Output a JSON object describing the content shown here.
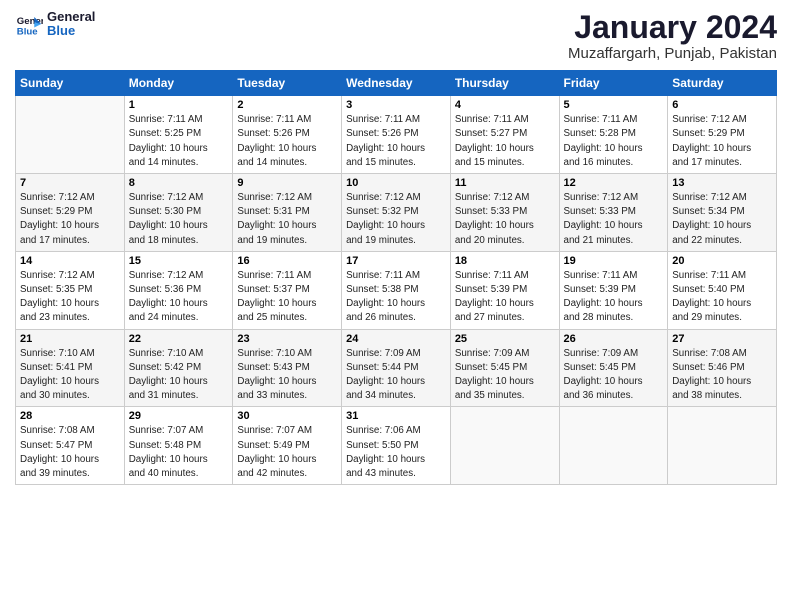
{
  "logo": {
    "line1": "General",
    "line2": "Blue"
  },
  "title": "January 2024",
  "subtitle": "Muzaffargarh, Punjab, Pakistan",
  "days_header": [
    "Sunday",
    "Monday",
    "Tuesday",
    "Wednesday",
    "Thursday",
    "Friday",
    "Saturday"
  ],
  "weeks": [
    [
      {
        "num": "",
        "info": ""
      },
      {
        "num": "1",
        "info": "Sunrise: 7:11 AM\nSunset: 5:25 PM\nDaylight: 10 hours\nand 14 minutes."
      },
      {
        "num": "2",
        "info": "Sunrise: 7:11 AM\nSunset: 5:26 PM\nDaylight: 10 hours\nand 14 minutes."
      },
      {
        "num": "3",
        "info": "Sunrise: 7:11 AM\nSunset: 5:26 PM\nDaylight: 10 hours\nand 15 minutes."
      },
      {
        "num": "4",
        "info": "Sunrise: 7:11 AM\nSunset: 5:27 PM\nDaylight: 10 hours\nand 15 minutes."
      },
      {
        "num": "5",
        "info": "Sunrise: 7:11 AM\nSunset: 5:28 PM\nDaylight: 10 hours\nand 16 minutes."
      },
      {
        "num": "6",
        "info": "Sunrise: 7:12 AM\nSunset: 5:29 PM\nDaylight: 10 hours\nand 17 minutes."
      }
    ],
    [
      {
        "num": "7",
        "info": "Sunrise: 7:12 AM\nSunset: 5:29 PM\nDaylight: 10 hours\nand 17 minutes."
      },
      {
        "num": "8",
        "info": "Sunrise: 7:12 AM\nSunset: 5:30 PM\nDaylight: 10 hours\nand 18 minutes."
      },
      {
        "num": "9",
        "info": "Sunrise: 7:12 AM\nSunset: 5:31 PM\nDaylight: 10 hours\nand 19 minutes."
      },
      {
        "num": "10",
        "info": "Sunrise: 7:12 AM\nSunset: 5:32 PM\nDaylight: 10 hours\nand 19 minutes."
      },
      {
        "num": "11",
        "info": "Sunrise: 7:12 AM\nSunset: 5:33 PM\nDaylight: 10 hours\nand 20 minutes."
      },
      {
        "num": "12",
        "info": "Sunrise: 7:12 AM\nSunset: 5:33 PM\nDaylight: 10 hours\nand 21 minutes."
      },
      {
        "num": "13",
        "info": "Sunrise: 7:12 AM\nSunset: 5:34 PM\nDaylight: 10 hours\nand 22 minutes."
      }
    ],
    [
      {
        "num": "14",
        "info": "Sunrise: 7:12 AM\nSunset: 5:35 PM\nDaylight: 10 hours\nand 23 minutes."
      },
      {
        "num": "15",
        "info": "Sunrise: 7:12 AM\nSunset: 5:36 PM\nDaylight: 10 hours\nand 24 minutes."
      },
      {
        "num": "16",
        "info": "Sunrise: 7:11 AM\nSunset: 5:37 PM\nDaylight: 10 hours\nand 25 minutes."
      },
      {
        "num": "17",
        "info": "Sunrise: 7:11 AM\nSunset: 5:38 PM\nDaylight: 10 hours\nand 26 minutes."
      },
      {
        "num": "18",
        "info": "Sunrise: 7:11 AM\nSunset: 5:39 PM\nDaylight: 10 hours\nand 27 minutes."
      },
      {
        "num": "19",
        "info": "Sunrise: 7:11 AM\nSunset: 5:39 PM\nDaylight: 10 hours\nand 28 minutes."
      },
      {
        "num": "20",
        "info": "Sunrise: 7:11 AM\nSunset: 5:40 PM\nDaylight: 10 hours\nand 29 minutes."
      }
    ],
    [
      {
        "num": "21",
        "info": "Sunrise: 7:10 AM\nSunset: 5:41 PM\nDaylight: 10 hours\nand 30 minutes."
      },
      {
        "num": "22",
        "info": "Sunrise: 7:10 AM\nSunset: 5:42 PM\nDaylight: 10 hours\nand 31 minutes."
      },
      {
        "num": "23",
        "info": "Sunrise: 7:10 AM\nSunset: 5:43 PM\nDaylight: 10 hours\nand 33 minutes."
      },
      {
        "num": "24",
        "info": "Sunrise: 7:09 AM\nSunset: 5:44 PM\nDaylight: 10 hours\nand 34 minutes."
      },
      {
        "num": "25",
        "info": "Sunrise: 7:09 AM\nSunset: 5:45 PM\nDaylight: 10 hours\nand 35 minutes."
      },
      {
        "num": "26",
        "info": "Sunrise: 7:09 AM\nSunset: 5:45 PM\nDaylight: 10 hours\nand 36 minutes."
      },
      {
        "num": "27",
        "info": "Sunrise: 7:08 AM\nSunset: 5:46 PM\nDaylight: 10 hours\nand 38 minutes."
      }
    ],
    [
      {
        "num": "28",
        "info": "Sunrise: 7:08 AM\nSunset: 5:47 PM\nDaylight: 10 hours\nand 39 minutes."
      },
      {
        "num": "29",
        "info": "Sunrise: 7:07 AM\nSunset: 5:48 PM\nDaylight: 10 hours\nand 40 minutes."
      },
      {
        "num": "30",
        "info": "Sunrise: 7:07 AM\nSunset: 5:49 PM\nDaylight: 10 hours\nand 42 minutes."
      },
      {
        "num": "31",
        "info": "Sunrise: 7:06 AM\nSunset: 5:50 PM\nDaylight: 10 hours\nand 43 minutes."
      },
      {
        "num": "",
        "info": ""
      },
      {
        "num": "",
        "info": ""
      },
      {
        "num": "",
        "info": ""
      }
    ]
  ]
}
